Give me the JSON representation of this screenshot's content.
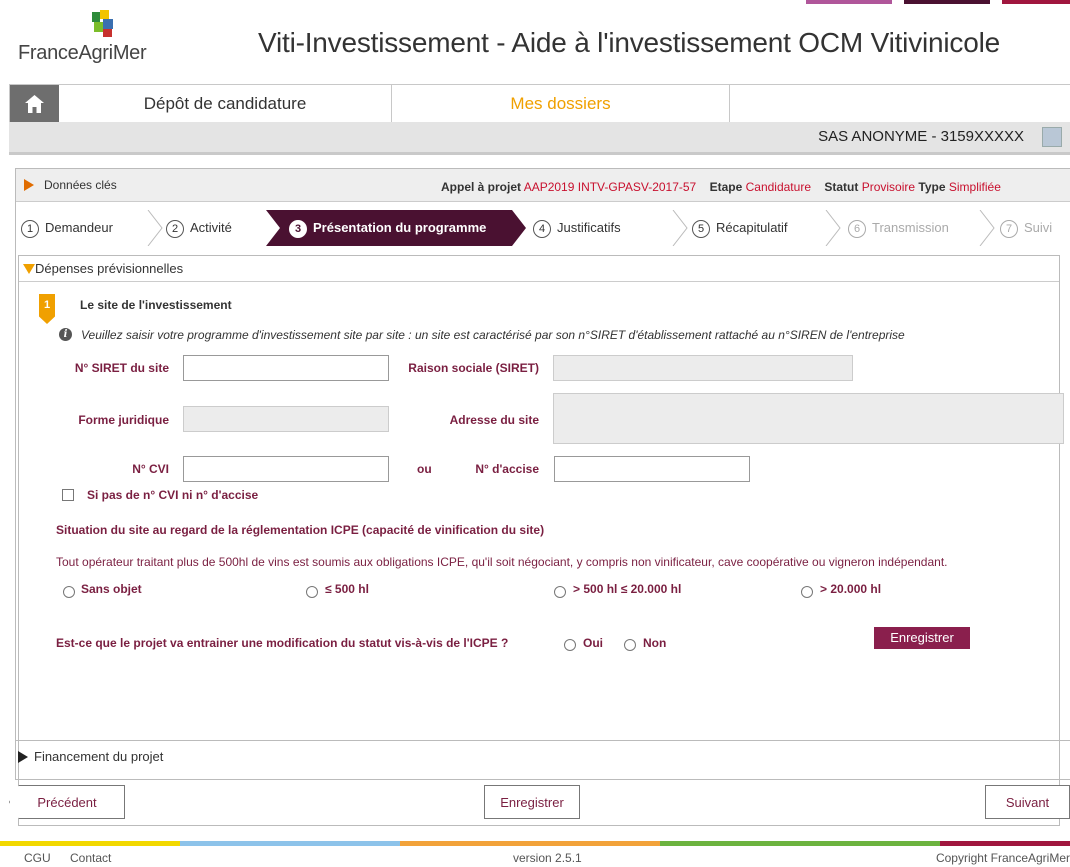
{
  "colors": {
    "accent": "#4a1131",
    "orange": "#f0a000",
    "label": "#7a1f41",
    "red": "#c8102e",
    "save": "#8a1f4d"
  },
  "header": {
    "brand": "FranceAgriMer",
    "title": "Viti-Investissement - Aide à l'investissement OCM Vitivinicole"
  },
  "nav": {
    "home_icon": "home-icon",
    "tabs": [
      {
        "label": "Dépôt de candidature"
      },
      {
        "label": "Mes dossiers"
      }
    ]
  },
  "user": {
    "label": "SAS ANONYME - 3159XXXXX",
    "icon": "user-icon"
  },
  "keydata": {
    "title": "Données clés",
    "appel_label": "Appel à projet",
    "appel_value": "AAP2019 INTV-GPASV-2017-57",
    "etape_label": "Etape",
    "etape_value": "Candidature",
    "statut_label": "Statut",
    "statut_value": "Provisoire",
    "type_label": "Type",
    "type_value": "Simplifiée"
  },
  "steps": [
    {
      "num": "1",
      "label": "Demandeur"
    },
    {
      "num": "2",
      "label": "Activité"
    },
    {
      "num": "3",
      "label": "Présentation du programme"
    },
    {
      "num": "4",
      "label": "Justificatifs"
    },
    {
      "num": "5",
      "label": "Récapitulatif"
    },
    {
      "num": "6",
      "label": "Transmission"
    },
    {
      "num": "7",
      "label": "Suivi"
    }
  ],
  "depenses": {
    "title": "Dépenses prévisionnelles",
    "section_num": "1",
    "section_title": "Le site de l'investissement",
    "info": "Veuillez saisir votre programme d'investissement site par site : un site est caractérisé par son n°SIRET d'établissement rattaché au n°SIREN de l'entreprise",
    "fields": {
      "siret_label": "N° SIRET du site",
      "siret_value": "",
      "raison_label": "Raison sociale (SIRET)",
      "raison_value": "",
      "forme_label": "Forme juridique",
      "forme_value": "",
      "adresse_label": "Adresse du site",
      "adresse_value": "",
      "cvi_label": "N° CVI",
      "cvi_value": "",
      "ou": "ou",
      "accise_label": "N° d'accise",
      "accise_value": ""
    },
    "checkbox_label": "Si pas de n° CVI ni n° d'accise",
    "icpe_title": "Situation du site au regard de la réglementation ICPE (capacité de vinification du site)",
    "icpe_text": "Tout opérateur traitant plus de 500hl de vins est soumis aux obligations ICPE, qu'il soit négociant, y compris non vinificateur, cave coopérative ou vigneron indépendant.",
    "icpe_options": [
      "Sans objet",
      "≤ 500 hl",
      "> 500 hl ≤ 20.000 hl",
      "> 20.000 hl"
    ],
    "question": "Est-ce que le projet va entrainer une modification du statut vis-à-vis de l'ICPE ?",
    "question_options": [
      "Oui",
      "Non"
    ],
    "save_label": "Enregistrer"
  },
  "financement": {
    "title": "Financement du projet"
  },
  "buttons": {
    "prev": "Précédent",
    "save": "Enregistrer",
    "next": "Suivant"
  },
  "footer": {
    "cgu": "CGU",
    "contact": "Contact",
    "version": "version 2.5.1",
    "copyright": "Copyright FranceAgriMer"
  }
}
